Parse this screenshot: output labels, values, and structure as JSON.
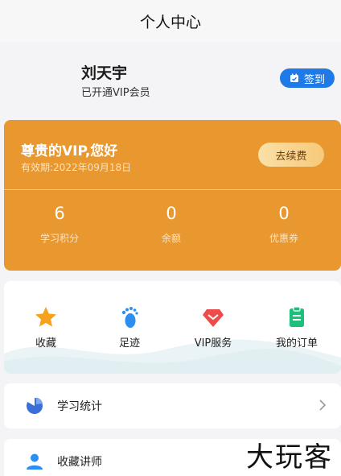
{
  "header": {
    "title": "个人中心"
  },
  "profile": {
    "name": "刘天宇",
    "vip_status": "已开通VIP会员",
    "checkin_label": "签到"
  },
  "vip_card": {
    "greeting": "尊贵的VIP,您好",
    "expire": "有效期:2022年09月18日",
    "renew_label": "去续费",
    "stats": [
      {
        "value": "6",
        "label": "学习积分"
      },
      {
        "value": "0",
        "label": "余额"
      },
      {
        "value": "0",
        "label": "优惠券"
      }
    ]
  },
  "quick_actions": [
    {
      "label": "收藏",
      "icon": "star-icon"
    },
    {
      "label": "足迹",
      "icon": "footprint-icon"
    },
    {
      "label": "VIP服务",
      "icon": "diamond-icon"
    },
    {
      "label": "我的订单",
      "icon": "order-icon"
    }
  ],
  "menu": [
    {
      "label": "学习统计",
      "icon": "pie-chart-icon"
    },
    {
      "label": "收藏讲师",
      "icon": "person-icon"
    }
  ],
  "watermark": "大玩客",
  "colors": {
    "vip_card": "#e8982f",
    "checkin": "#1f7ae8",
    "star": "#f6a21e",
    "footprint": "#2c8ef0",
    "diamond": "#ee4b4b",
    "order": "#1cc07a"
  }
}
